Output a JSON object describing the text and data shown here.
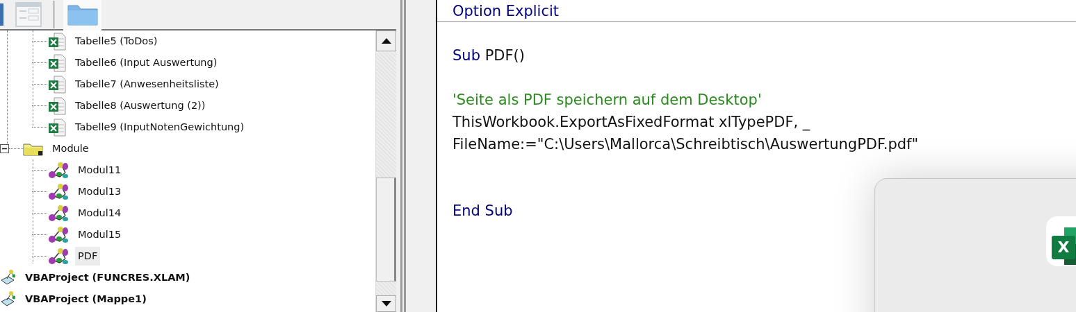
{
  "toolbar": {
    "buttons": [
      {
        "kind": "partial",
        "disabled": false
      },
      {
        "kind": "form",
        "disabled": true
      },
      {
        "kind": "folder",
        "disabled": false
      }
    ]
  },
  "project_tree": {
    "continued_children": [
      {
        "kind": "sheet",
        "label": "Tabelle5 (ToDos)",
        "selected": false
      },
      {
        "kind": "sheet",
        "label": "Tabelle6 (Input Auswertung)",
        "selected": false
      },
      {
        "kind": "sheet",
        "label": "Tabelle7 (Anwesenheitsliste)",
        "selected": false
      },
      {
        "kind": "sheet",
        "label": "Tabelle8 (Auswertung (2))",
        "selected": false
      },
      {
        "kind": "sheet",
        "label": "Tabelle9 (InputNotenGewichtung)",
        "selected": false
      }
    ],
    "items": [
      {
        "kind": "folder",
        "label": "Module",
        "expanded": true,
        "selected": false,
        "children": [
          {
            "kind": "module",
            "label": "Modul11",
            "selected": false
          },
          {
            "kind": "module",
            "label": "Modul13",
            "selected": false
          },
          {
            "kind": "module",
            "label": "Modul14",
            "selected": false
          },
          {
            "kind": "module",
            "label": "Modul15",
            "selected": false
          },
          {
            "kind": "module",
            "label": "PDF",
            "selected": true
          }
        ]
      },
      {
        "kind": "project",
        "label": "VBAProject (FUNCRES.XLAM)",
        "selected": false
      },
      {
        "kind": "project",
        "label": "VBAProject (Mappe1)",
        "selected": false
      }
    ]
  },
  "code_editor": {
    "lines": [
      {
        "kind": "code",
        "segments": [
          {
            "kind": "keyword",
            "text": "Option Explicit"
          }
        ],
        "separator_after": true
      },
      {
        "kind": "blank"
      },
      {
        "kind": "code",
        "segments": [
          {
            "kind": "keyword",
            "text": "Sub"
          },
          {
            "kind": "plain",
            "text": " PDF()"
          }
        ]
      },
      {
        "kind": "blank"
      },
      {
        "kind": "code",
        "segments": [
          {
            "kind": "comment",
            "text": "'Seite als PDF speichern auf dem Desktop'"
          }
        ]
      },
      {
        "kind": "code",
        "segments": [
          {
            "kind": "plain",
            "text": "ThisWorkbook.ExportAsFixedFormat xlTypePDF, _"
          }
        ]
      },
      {
        "kind": "code",
        "segments": [
          {
            "kind": "plain",
            "text": "FileName:=\"C:\\Users\\Mallorca\\Schreibtisch\\AuswertungPDF.pdf\""
          }
        ]
      },
      {
        "kind": "blank"
      },
      {
        "kind": "blank"
      },
      {
        "kind": "code",
        "segments": [
          {
            "kind": "keyword",
            "text": "End Sub"
          }
        ]
      }
    ]
  },
  "dialog": {
    "app_icon_letter": "X"
  }
}
